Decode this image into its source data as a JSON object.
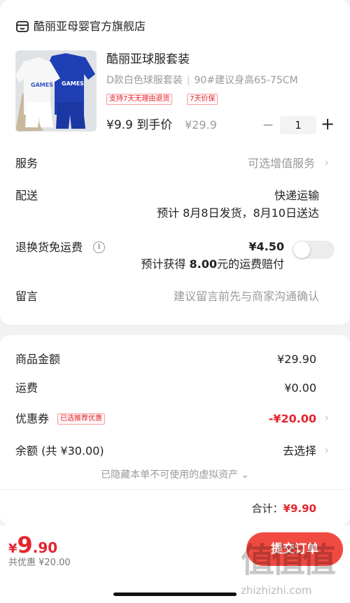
{
  "store": {
    "name": "酷丽亚母婴官方旗舰店",
    "icon": "store-icon"
  },
  "product": {
    "title": "酷丽亚球服套装",
    "spec": "D款白色球服套装",
    "size": "90#建议身高65-75CM",
    "tags": [
      "支持7天无理由退货",
      "7天价保"
    ],
    "price": "¥9.9 到手价",
    "original_price": "¥29.9",
    "quantity": "1",
    "minus": "−",
    "plus": "+",
    "image_text": "GAMES BASKETBALL"
  },
  "rows": {
    "service": {
      "label": "服务",
      "value": "可选增值服务"
    },
    "delivery": {
      "label": "配送",
      "value": "快递运输",
      "estimate": "预计 8月8日发货，8月10日送达"
    },
    "return_shipping": {
      "label": "退换货免运费",
      "price": "¥4.50",
      "note_prefix": "预计获得 ",
      "note_amount": "8.00",
      "note_suffix": "元的运费赔付",
      "toggle_on": false
    },
    "remark": {
      "label": "留言",
      "placeholder": "建议留言前先与商家沟通确认"
    }
  },
  "summary": {
    "goods_amount": {
      "label": "商品金额",
      "value": "¥29.90"
    },
    "shipping": {
      "label": "运费",
      "value": "¥0.00"
    },
    "coupon": {
      "label": "优惠券",
      "tag": "已选推荐优惠",
      "value": "-¥20.00"
    },
    "balance": {
      "label": "余额 (共 ¥30.00)",
      "value": "去选择"
    },
    "hidden_note": "已隐藏本单不可使用的虚拟资产",
    "total_label": "合计：",
    "total_value": "¥9.90"
  },
  "footer": {
    "currency": "¥",
    "price_int": "9",
    "price_dec": ".90",
    "discount": "共优惠 ¥20.00",
    "submit_label": "提交订单"
  },
  "watermark": {
    "glyphs": "值值值",
    "url": "zhizhizhi.com"
  },
  "colors": {
    "accent": "#e4252e",
    "button": "#f04a42",
    "background": "#f2f2f2"
  }
}
